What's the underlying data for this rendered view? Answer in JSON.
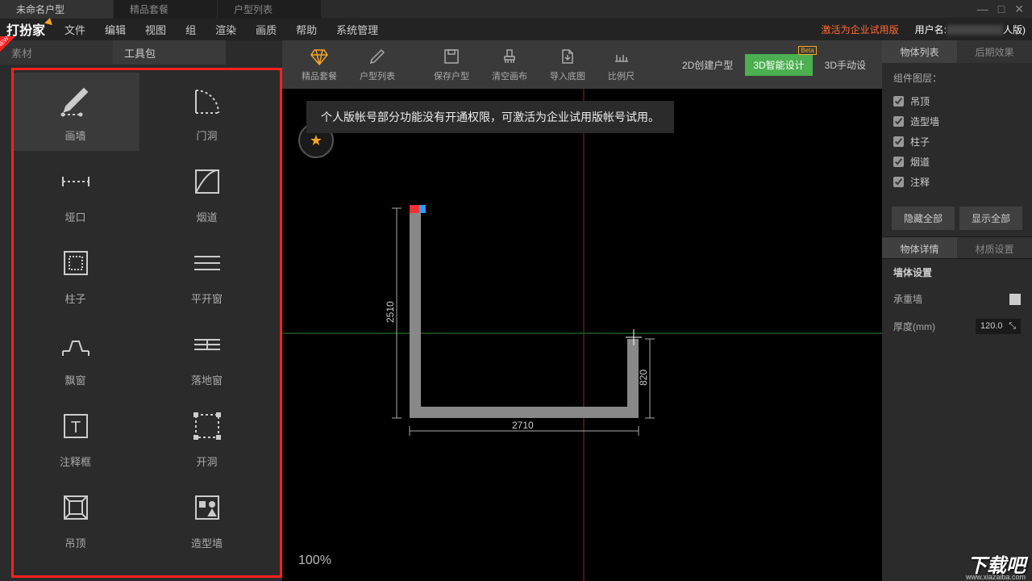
{
  "topTabs": [
    "未命名户型",
    "精品套餐",
    "户型列表"
  ],
  "menu": [
    "文件",
    "编辑",
    "视图",
    "组",
    "渲染",
    "画质",
    "帮助",
    "系统管理"
  ],
  "logo": "打扮家",
  "activation": "激活为企业试用版",
  "userLabel": "用户名:",
  "userSuffix": "人版)",
  "leftTabs": {
    "a": "素材",
    "b": "工具包"
  },
  "tools": [
    {
      "label": "画墙",
      "icon": "pencil"
    },
    {
      "label": "门洞",
      "icon": "arc"
    },
    {
      "label": "垭口",
      "icon": "dash-line"
    },
    {
      "label": "烟道",
      "icon": "curve-rect"
    },
    {
      "label": "柱子",
      "icon": "dot-rect"
    },
    {
      "label": "平开窗",
      "icon": "h-lines"
    },
    {
      "label": "飘窗",
      "icon": "bay"
    },
    {
      "label": "落地窗",
      "icon": "grid-win"
    },
    {
      "label": "注释框",
      "icon": "text"
    },
    {
      "label": "开洞",
      "icon": "dot-border"
    },
    {
      "label": "吊顶",
      "icon": "ceiling",
      "new": true
    },
    {
      "label": "造型墙",
      "icon": "shapes",
      "new": true
    }
  ],
  "toolbar": [
    "精品套餐",
    "户型列表",
    "保存户型",
    "清空画布",
    "导入底图",
    "比例尺"
  ],
  "modes": {
    "a": "2D创建户型",
    "b": "3D智能设计",
    "c": "3D手动设",
    "beta": "Beta"
  },
  "notice": "个人版帐号部分功能没有开通权限，可激活为企业试用版帐号试用。",
  "zoom": "100%",
  "dims": {
    "w": "2710",
    "h": "2510",
    "r": "820"
  },
  "rightTabs": {
    "a": "物体列表",
    "b": "后期效果"
  },
  "layers": {
    "title": "组件图层：",
    "items": [
      "吊顶",
      "造型墙",
      "柱子",
      "烟道",
      "注释"
    ]
  },
  "btns": {
    "hide": "隐藏全部",
    "show": "显示全部"
  },
  "rightTabs2": {
    "a": "物体详情",
    "b": "材质设置"
  },
  "wallSetting": "墙体设置",
  "bearing": "承重墙",
  "thickness": {
    "label": "厚度(mm)",
    "value": "120.0"
  },
  "watermark": "下载吧",
  "watermarkUrl": "www.xiazaiba.com"
}
